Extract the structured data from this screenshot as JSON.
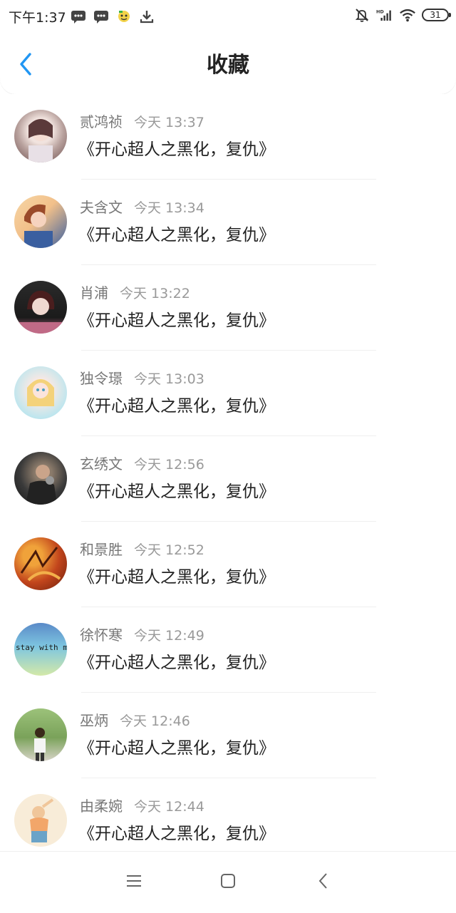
{
  "status_bar": {
    "time": "下午1:37",
    "left_icons": [
      "chat-bubble-icon",
      "chat-bubble-icon",
      "app-icon",
      "download-icon"
    ],
    "right_icons": [
      "silent-bell-icon",
      "hd-signal-icon",
      "wifi-icon"
    ],
    "battery": "31"
  },
  "header": {
    "title": "收藏",
    "back_icon": "chevron-left-icon",
    "accent_color": "#2196F3"
  },
  "items": [
    {
      "user": "贰鸿祯",
      "time": "今天 13:37",
      "title": "《开心超人之黑化，复仇》",
      "avatar_colors": [
        "#d8c8c4",
        "#6a4b4b"
      ]
    },
    {
      "user": "夫含文",
      "time": "今天 13:34",
      "title": "《开心超人之黑化，复仇》",
      "avatar_colors": [
        "#f2c08a",
        "#3a5fa0"
      ]
    },
    {
      "user": "肖浦",
      "time": "今天 13:22",
      "title": "《开心超人之黑化，复仇》",
      "avatar_colors": [
        "#1b1b1b",
        "#c06a86"
      ]
    },
    {
      "user": "独令璟",
      "time": "今天 13:03",
      "title": "《开心超人之黑化，复仇》",
      "avatar_colors": [
        "#bfe6ee",
        "#f2c7b8"
      ]
    },
    {
      "user": "玄绣文",
      "time": "今天 12:56",
      "title": "《开心超人之黑化，复仇》",
      "avatar_colors": [
        "#2a2a2a",
        "#8a7a6a"
      ]
    },
    {
      "user": "和景胜",
      "time": "今天 12:52",
      "title": "《开心超人之黑化，复仇》",
      "avatar_colors": [
        "#c2451c",
        "#f0a23a"
      ]
    },
    {
      "user": "徐怀寒",
      "time": "今天 12:49",
      "title": "《开心超人之黑化，复仇》",
      "avatar_colors": [
        "#7ec6e0",
        "#d4e9a8"
      ],
      "avatar_text": "stay with m"
    },
    {
      "user": "巫炳",
      "time": "今天 12:46",
      "title": "《开心超人之黑化，复仇》",
      "avatar_colors": [
        "#7aa25a",
        "#e8e8e8"
      ]
    },
    {
      "user": "由柔婉",
      "time": "今天 12:44",
      "title": "《开心超人之黑化，复仇》",
      "avatar_colors": [
        "#f8e6cc",
        "#6aa3c8"
      ]
    }
  ],
  "nav": {
    "menu_icon": "menu-icon",
    "home_icon": "square-home-icon",
    "back_icon": "back-triangle-icon"
  }
}
